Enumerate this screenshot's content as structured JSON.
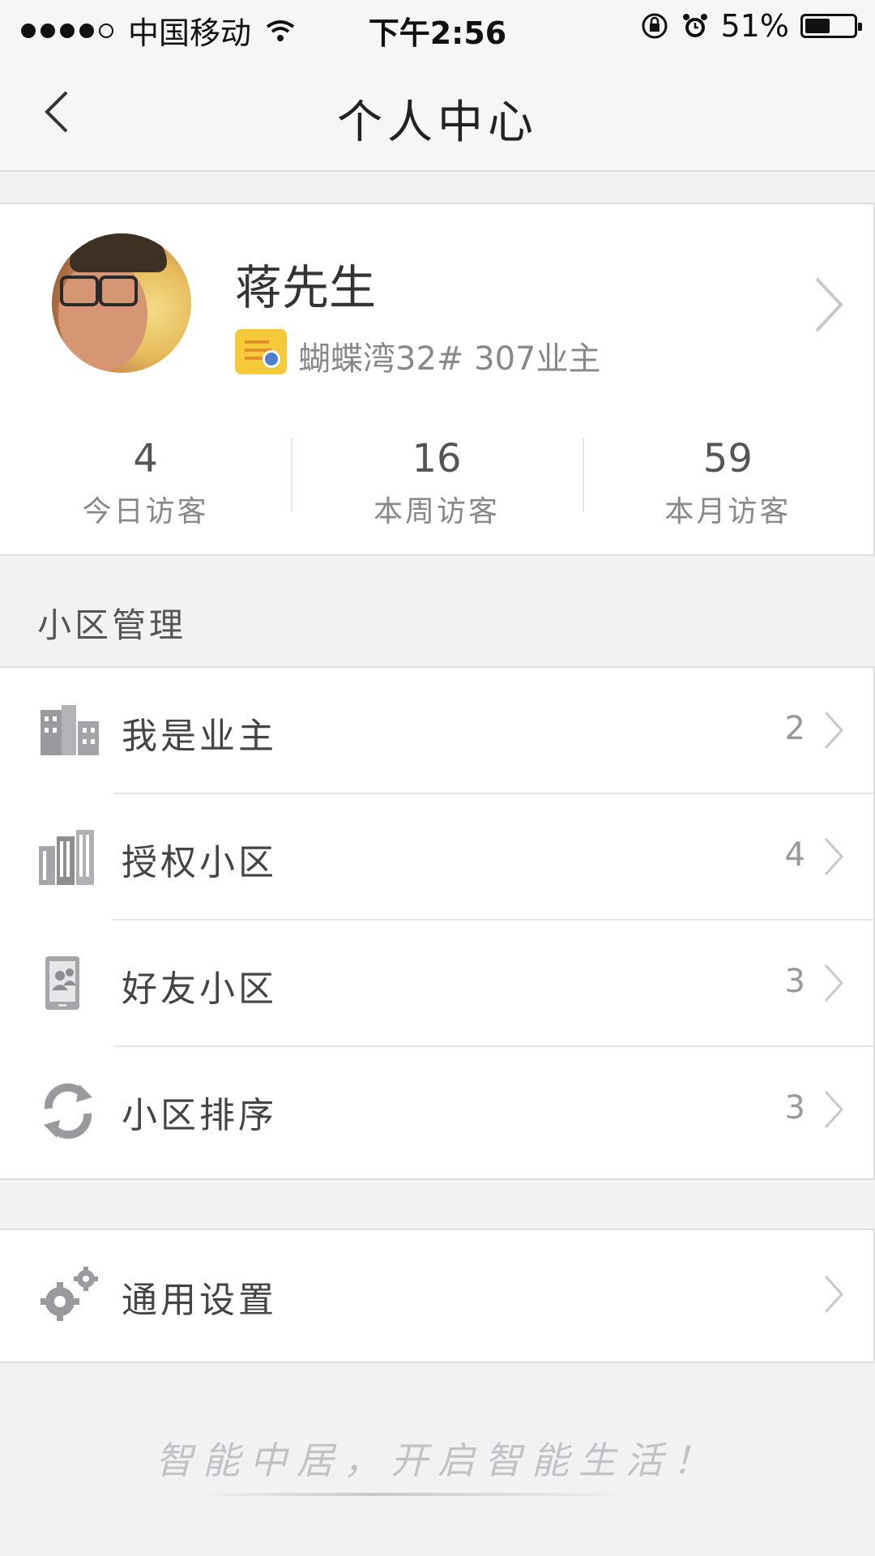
{
  "status_bar": {
    "carrier": "中国移动",
    "time": "下午2:56",
    "battery": "51%",
    "battery_level": 0.51,
    "signal_bars": 4
  },
  "nav": {
    "title": "个人中心",
    "back_icon": "chevron-left-icon"
  },
  "profile": {
    "name": "蒋先生",
    "address": "蝴蝶湾32#  307业主",
    "badge_icon": "certificate-icon"
  },
  "stats": [
    {
      "value": "4",
      "label": "今日访客"
    },
    {
      "value": "16",
      "label": "本周访客"
    },
    {
      "value": "59",
      "label": "本月访客"
    }
  ],
  "section": {
    "title": "小区管理"
  },
  "menu": [
    {
      "label": "我是业主",
      "count": "2",
      "icon": "buildings-icon"
    },
    {
      "label": "授权小区",
      "count": "4",
      "icon": "city-icon"
    },
    {
      "label": "好友小区",
      "count": "3",
      "icon": "friends-device-icon"
    },
    {
      "label": "小区排序",
      "count": "3",
      "icon": "refresh-icon"
    }
  ],
  "settings": {
    "label": "通用设置",
    "icon": "gears-icon"
  },
  "footer": {
    "slogan": "智能中居，开启智能生活！"
  },
  "colors": {
    "background": "#f2f2f5",
    "badge": "#f6c93a",
    "text": "#444444",
    "muted": "#999999"
  }
}
